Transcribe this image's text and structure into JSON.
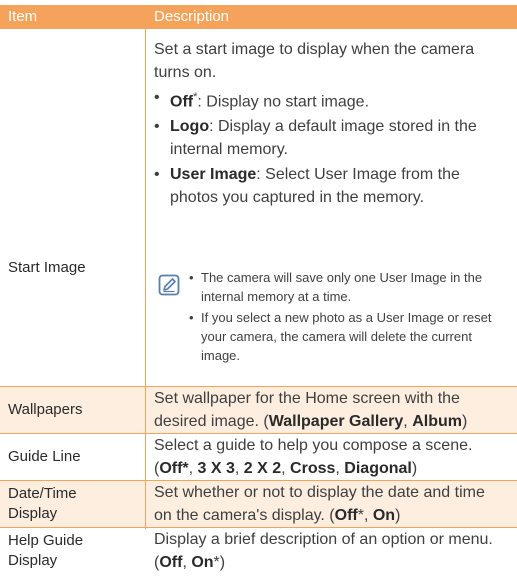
{
  "header": {
    "item": "Item",
    "description": "Description"
  },
  "rows": [
    {
      "item": "Start Image",
      "intro": "Set a start image to display when the camera turns on.",
      "bullets": [
        {
          "term": "Off",
          "mark": "*",
          "text": ": Display no start image."
        },
        {
          "term": "Logo",
          "mark": "",
          "text": ": Display a default image stored in the internal memory."
        },
        {
          "term": "User Image",
          "mark": "",
          "text": ": Select User Image from the photos you captured in the memory."
        }
      ],
      "note_icon": "note-pencil-icon",
      "notes": [
        "The camera will save only one User Image in the internal memory at a time.",
        "If you select a new photo as a User Image or reset your camera, the camera will delete the current image."
      ]
    },
    {
      "item": "Wallpapers",
      "text": "Set wallpaper for the Home screen with the desired image. (",
      "options": [
        "Wallpaper Gallery",
        "Album"
      ]
    },
    {
      "item": "Guide Line",
      "text": "Select a guide to help you compose a scene. (",
      "options": [
        "Off*",
        "3 X 3",
        "2 X 2",
        "Cross",
        "Diagonal"
      ]
    },
    {
      "item_line1": "Date/Time",
      "item_line2": "Display",
      "text": "Set whether or not to display the date and time on the camera's display. (",
      "options": [
        "Off*",
        "On"
      ]
    },
    {
      "item_line1": "Help Guide",
      "item_line2": "Display",
      "text": "Display a brief description of an option or menu. (",
      "options": [
        "Off",
        "On*"
      ]
    }
  ],
  "colors": {
    "header_bg": "#f5a25b",
    "alt_row_bg": "#fdeee0",
    "rule": "#f5a25b"
  }
}
